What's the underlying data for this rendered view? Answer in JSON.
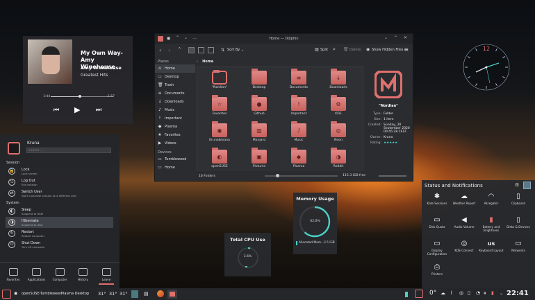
{
  "media": {
    "title": "My Own Way-Amy Winehouse",
    "artist": "Amy Winehouse",
    "album": "Greatest Hits",
    "elapsed": "1:44",
    "remaining": "-1:57",
    "progress": 0.47
  },
  "dolphin": {
    "window_title": "Home — Dolphin",
    "sort_label": "Sort By",
    "split_label": "Split",
    "delete_label": "Delete",
    "hidden_files_label": "Show Hidden Files",
    "breadcrumb": "Home",
    "places_header": "Places",
    "places": [
      "Home",
      "Desktop",
      "Trash",
      "Documents",
      "Downloads",
      "Music",
      "Important",
      "Plasma",
      "Favorites",
      "Videos"
    ],
    "devices_header": "Devices",
    "devices": [
      "Tumbleweed",
      "Home"
    ],
    "items": [
      {
        "label": "\"Nordian\"",
        "glyph": "N"
      },
      {
        "label": "Desktop",
        "glyph": ""
      },
      {
        "label": "Documents",
        "glyph": "≡"
      },
      {
        "label": "Downloads",
        "glyph": "↓"
      },
      {
        "label": "Favorites",
        "glyph": "☆"
      },
      {
        "label": "Github",
        "glyph": "●"
      },
      {
        "label": "Important",
        "glyph": "!"
      },
      {
        "label": "KDE",
        "glyph": "⚙"
      },
      {
        "label": "Kruna&Ivana",
        "glyph": "◉"
      },
      {
        "label": "Manjaro",
        "glyph": "▥"
      },
      {
        "label": "Music",
        "glyph": "♪"
      },
      {
        "label": "Neon",
        "glyph": "◎"
      },
      {
        "label": "openSUSE",
        "glyph": "◐"
      },
      {
        "label": "Pictures",
        "glyph": "▣"
      },
      {
        "label": "Plasma",
        "glyph": "◆"
      },
      {
        "label": "Reddit",
        "glyph": "◑"
      }
    ],
    "info": {
      "name": "\"Nordian\"",
      "rows": [
        {
          "k": "Type:",
          "v": "Folder"
        },
        {
          "k": "Size:",
          "v": "1 item"
        },
        {
          "k": "Created:",
          "v": "Sunday, 20 September 2020 00:45:28 CEST"
        },
        {
          "k": "Owner:",
          "v": "Kruna"
        },
        {
          "k": "Rating:",
          "v": "★★★★★"
        }
      ]
    },
    "status_count": "16 Folders",
    "status_free": "115.3 GiB free"
  },
  "clock": {
    "numeral": "12"
  },
  "kicker": {
    "user": "Kruna",
    "search_placeholder": "Search...",
    "session_header": "Session",
    "system_header": "System",
    "session": [
      {
        "t": "Lock",
        "s": "Lock screen"
      },
      {
        "t": "Log Out",
        "s": "End session"
      },
      {
        "t": "Switch User",
        "s": "Start a parallel session as a different user"
      }
    ],
    "system": [
      {
        "t": "Sleep",
        "s": "Suspend to RAM"
      },
      {
        "t": "Hibernate",
        "s": "Suspend to disk"
      },
      {
        "t": "Restart",
        "s": "Restart computer"
      },
      {
        "t": "Shut Down",
        "s": "Turn off computer"
      }
    ],
    "tabs": [
      "Favorites",
      "Applications",
      "Computer",
      "History",
      "Leave"
    ]
  },
  "cpu": {
    "title": "Total CPU Use",
    "value": "3.6%",
    "fraction": 0.036
  },
  "memory": {
    "title": "Memory Usage",
    "value": "62.0%",
    "fraction": 0.62,
    "legend": "Allocated Mem...",
    "legend_value": "3.5 GiB"
  },
  "status": {
    "title": "Status and Notifications",
    "items": [
      {
        "label": "Kate Sessions",
        "icon": "✱"
      },
      {
        "label": "Weather Report",
        "icon": "☁"
      },
      {
        "label": "Akregator",
        "icon": "◠"
      },
      {
        "label": "Clipboard",
        "icon": "▯"
      },
      {
        "label": "Disk Quota",
        "icon": "▭"
      },
      {
        "label": "Audio Volume",
        "icon": "◀"
      },
      {
        "label": "Battery and Brightness",
        "icon": "▮"
      },
      {
        "label": "Disks & Devices",
        "icon": "▯"
      },
      {
        "label": "Display Configuration",
        "icon": "▭"
      },
      {
        "label": "KDE Connect",
        "icon": "◎"
      },
      {
        "label": "Keyboard Layout",
        "icon": "us"
      },
      {
        "label": "Networks",
        "icon": "▭"
      },
      {
        "label": "Printers",
        "icon": "⎙"
      }
    ]
  },
  "taskbar": {
    "activity": "openSUSE-Tumbleweed",
    "desktop": "Plasma Desktop",
    "temps": [
      "31°",
      "31°",
      "31°"
    ],
    "weather": "0°",
    "time": "22:41"
  },
  "colors": {
    "accent": "#e0706c",
    "panel": "#26282c"
  }
}
